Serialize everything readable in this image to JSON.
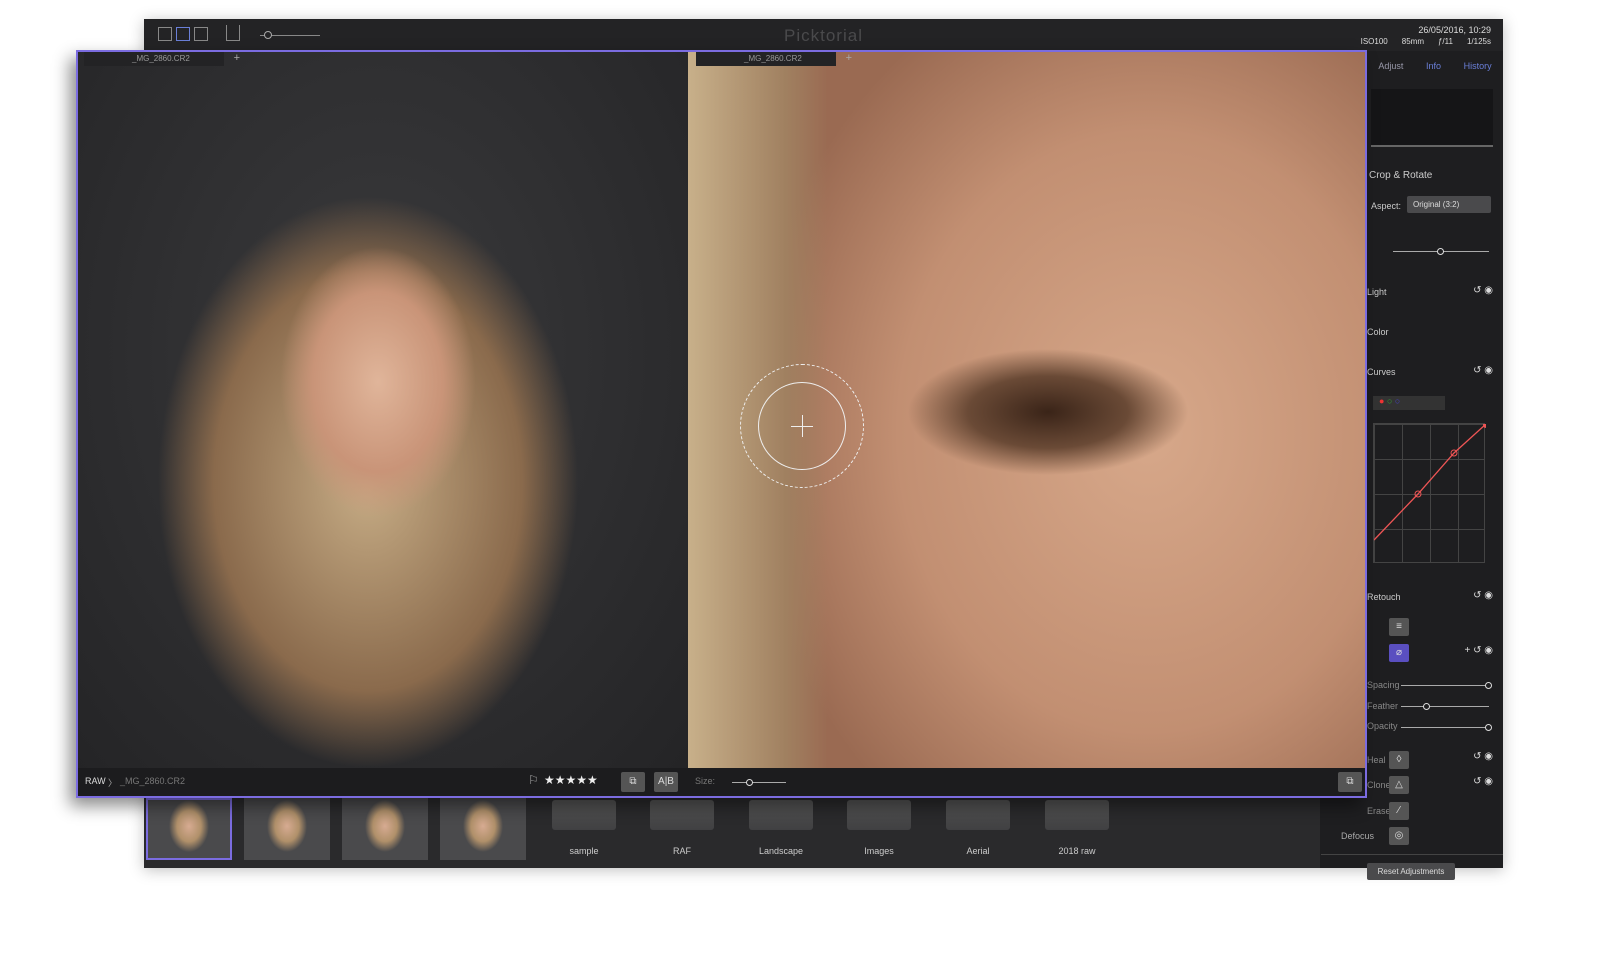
{
  "app": {
    "title": "Picktorial"
  },
  "meta": {
    "date": "26/05/2016, 10:29",
    "iso": "ISO100",
    "focal": "85mm",
    "aperture": "ƒ/11",
    "shutter": "1/125s"
  },
  "panel": {
    "tabs": [
      "Adjust",
      "Info",
      "History"
    ],
    "crop": {
      "label": "Crop & Rotate",
      "aspect_label": "Aspect:",
      "aspect_value": "Original (3:2)"
    },
    "sections": [
      "Light",
      "Color",
      "Curves",
      "Retouch"
    ],
    "retouch_sliders": [
      "Spacing",
      "Feather",
      "Opacity"
    ],
    "tools": [
      "Heal",
      "Clone",
      "Erase",
      "Defocus"
    ],
    "reset": "Reset Adjustments"
  },
  "compare": {
    "left_tab": "_MG_2860.CR2",
    "right_tab": "_MG_2860.CR2",
    "breadcrumb_root": "RAW",
    "breadcrumb_file": "_MG_2860.CR2",
    "stars": "★★★★★",
    "ab_label": "A|B",
    "size_label": "Size:"
  },
  "filmstrip": {
    "thumb_count": 4,
    "folders": [
      "sample",
      "RAF",
      "Landscape",
      "Images",
      "Aerial",
      "2018 raw"
    ]
  }
}
